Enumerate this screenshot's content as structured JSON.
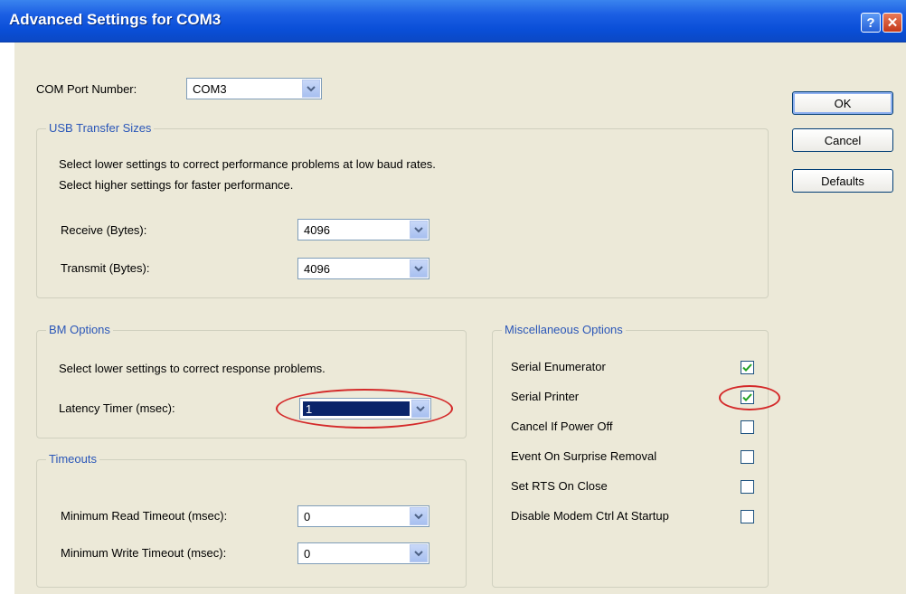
{
  "window": {
    "title": "Advanced Settings for COM3",
    "help_label": "?",
    "close_label": "✕"
  },
  "com_port": {
    "label": "COM Port Number:",
    "value": "COM3"
  },
  "buttons": {
    "ok": "OK",
    "cancel": "Cancel",
    "defaults": "Defaults"
  },
  "usb_transfer": {
    "title": "USB Transfer Sizes",
    "line1": "Select lower settings to correct performance problems at low baud rates.",
    "line2": "Select higher settings for faster performance.",
    "receive_label": "Receive (Bytes):",
    "receive_value": "4096",
    "transmit_label": "Transmit (Bytes):",
    "transmit_value": "4096"
  },
  "bm_options": {
    "title": "BM Options",
    "line1": "Select lower settings to correct response problems.",
    "latency_label": "Latency Timer (msec):",
    "latency_value": "1"
  },
  "timeouts": {
    "title": "Timeouts",
    "read_label": "Minimum Read Timeout (msec):",
    "read_value": "0",
    "write_label": "Minimum Write Timeout (msec):",
    "write_value": "0"
  },
  "misc": {
    "title": "Miscellaneous Options",
    "items": [
      {
        "label": "Serial Enumerator",
        "checked": true
      },
      {
        "label": "Serial Printer",
        "checked": true
      },
      {
        "label": "Cancel If Power Off",
        "checked": false
      },
      {
        "label": "Event On Surprise Removal",
        "checked": false
      },
      {
        "label": "Set RTS On Close",
        "checked": false
      },
      {
        "label": "Disable Modem Ctrl At Startup",
        "checked": false
      }
    ]
  },
  "colors": {
    "titlebar": "#0a4fd8",
    "dialog_bg": "#ece9d8",
    "group_title": "#2a56b8",
    "highlight_ellipse": "#d42a2a",
    "selection": "#0a246a"
  }
}
